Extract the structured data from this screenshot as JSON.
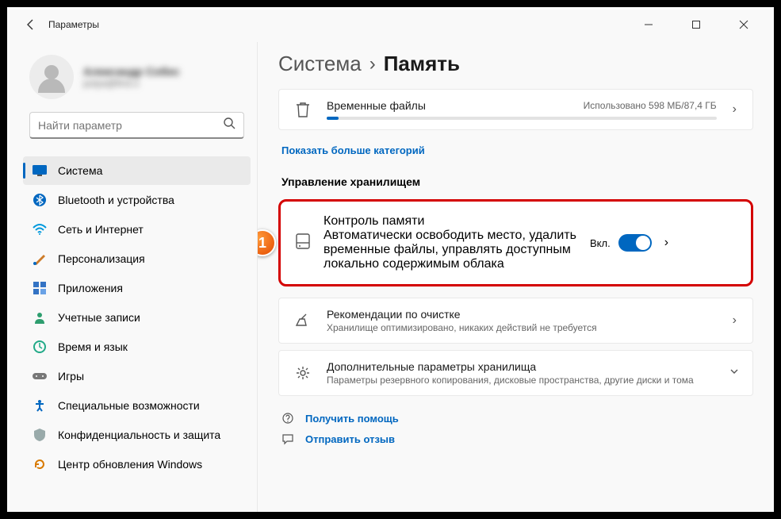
{
  "titlebar": {
    "title": "Параметры"
  },
  "profile": {
    "name": "Александр Собес",
    "email": "putya@first.s"
  },
  "search": {
    "placeholder": "Найти параметр"
  },
  "sidebar": {
    "items": [
      {
        "label": "Система"
      },
      {
        "label": "Bluetooth и устройства"
      },
      {
        "label": "Сеть и Интернет"
      },
      {
        "label": "Персонализация"
      },
      {
        "label": "Приложения"
      },
      {
        "label": "Учетные записи"
      },
      {
        "label": "Время и язык"
      },
      {
        "label": "Игры"
      },
      {
        "label": "Специальные возможности"
      },
      {
        "label": "Конфиденциальность и защита"
      },
      {
        "label": "Центр обновления Windows"
      }
    ]
  },
  "breadcrumb": {
    "parent": "Система",
    "current": "Память"
  },
  "temp": {
    "title": "Временные файлы",
    "usage": "Использовано 598 МБ/87,4 ГБ"
  },
  "show_more": "Показать больше категорий",
  "section": "Управление хранилищем",
  "marker": "1",
  "storage_sense": {
    "title": "Контроль памяти",
    "desc": "Автоматически освободить место, удалить временные файлы, управлять доступным локально содержимым облака",
    "toggle_label": "Вкл."
  },
  "cleanup": {
    "title": "Рекомендации по очистке",
    "desc": "Хранилище оптимизировано, никаких действий не требуется"
  },
  "advanced": {
    "title": "Дополнительные параметры хранилища",
    "desc": "Параметры резервного копирования, дисковые пространства, другие диски и тома"
  },
  "links": {
    "help": "Получить помощь",
    "feedback": "Отправить отзыв"
  }
}
